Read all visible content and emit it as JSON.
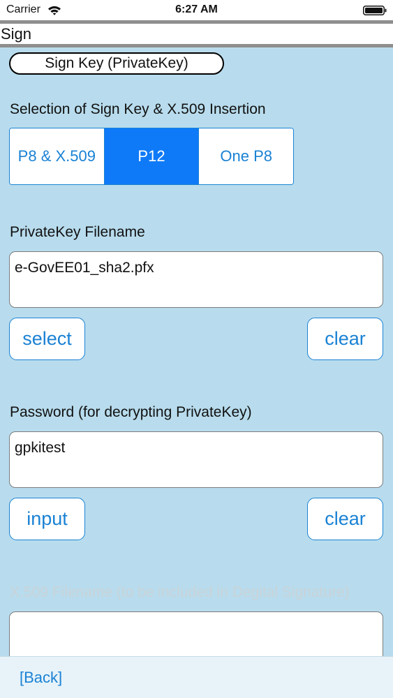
{
  "status_bar": {
    "carrier": "Carrier",
    "time": "6:27 AM",
    "wifi_icon": "wifi-icon",
    "battery_icon": "battery-icon"
  },
  "title_bar": {
    "title": "Sign"
  },
  "sign_key_header": {
    "label": "Sign Key (PrivateKey)"
  },
  "selection": {
    "label": "Selection of Sign Key & X.509 Insertion",
    "segments": [
      "P8 & X.509",
      "P12",
      "One P8"
    ],
    "selected": "P12"
  },
  "private_key": {
    "label": "PrivateKey Filename",
    "value": "e-GovEE01_sha2.pfx",
    "select_label": "select",
    "clear_label": "clear"
  },
  "password": {
    "label": "Password (for decrypting PrivateKey)",
    "value": "gpkitest",
    "input_label": "input",
    "clear_label": "clear"
  },
  "x509": {
    "label": "X.509 Filename (to be included in Degital Signature)",
    "value": ""
  },
  "bottom_bar": {
    "back_label": "[Back]"
  },
  "colors": {
    "background": "#b8dced",
    "accent": "#1a82d4",
    "segment_selected": "#0f7af7",
    "disabled_text": "#c9d3d9",
    "bottom_bar": "#e7f3f9"
  }
}
